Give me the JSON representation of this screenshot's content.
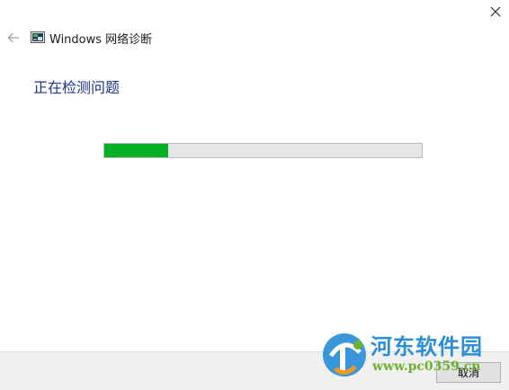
{
  "window": {
    "app_title": "Windows 网络诊断",
    "close_icon": "close-icon",
    "back_icon": "back-arrow-icon",
    "app_icon": "network-diagnostics-icon"
  },
  "main": {
    "heading": "正在检测问题",
    "progress_fraction": 0.2,
    "progress_color": "#06b025"
  },
  "footer": {
    "cancel_label": "取消"
  },
  "watermark": {
    "brand_text": "河东软件园",
    "url_text": "www.pc0359.cn",
    "logo_icon": "hedong-logo-icon"
  }
}
